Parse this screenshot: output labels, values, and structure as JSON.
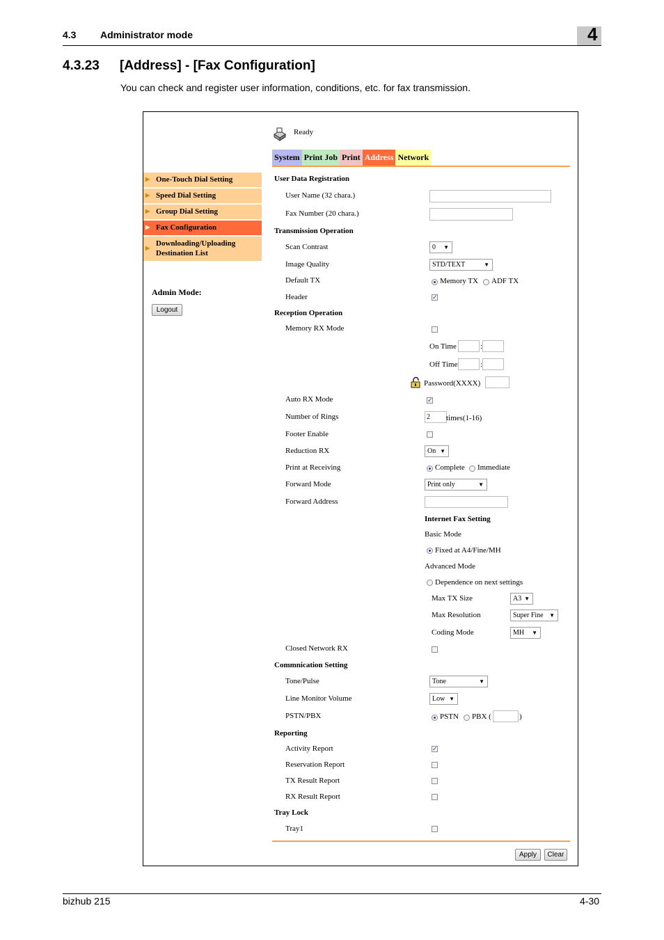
{
  "header": {
    "section_num": "4.3",
    "section_title": "Administrator mode",
    "chapter": "4"
  },
  "title": {
    "num": "4.3.23",
    "text": "[Address] - [Fax Configuration]"
  },
  "intro": "You can check and register user information, conditions, etc. for fax transmission.",
  "status": {
    "text": "Ready",
    "icon": "printer-icon"
  },
  "tabs": [
    "System",
    "Print Job",
    "Print",
    "Address",
    "Network"
  ],
  "active_tab": "Address",
  "sidebar": {
    "items": [
      {
        "label": "One-Touch Dial Setting"
      },
      {
        "label": "Speed Dial Setting"
      },
      {
        "label": "Group Dial Setting"
      },
      {
        "label": "Fax Configuration"
      },
      {
        "label1": "Downloading/Uploading",
        "label2": "Destination List"
      }
    ],
    "active": "Fax Configuration",
    "admin_mode_label": "Admin Mode:",
    "logout_label": "Logout"
  },
  "form": {
    "user_data": {
      "heading": "User Data Registration",
      "user_name_label": "User Name (32 chara.)",
      "user_name_value": "",
      "fax_number_label": "Fax Number (20 chara.)",
      "fax_number_value": ""
    },
    "transmission": {
      "heading": "Transmission Operation",
      "scan_contrast_label": "Scan Contrast",
      "scan_contrast_value": "0",
      "image_quality_label": "Image Quality",
      "image_quality_value": "STD/TEXT",
      "default_tx_label": "Default TX",
      "default_tx_opt1": "Memory TX",
      "default_tx_opt2": "ADF TX",
      "default_tx_selected": "Memory TX",
      "header_label": "Header",
      "header_checked": true
    },
    "reception": {
      "heading": "Reception Operation",
      "memory_rx_label": "Memory RX Mode",
      "memory_rx_checked": false,
      "on_time_label": "On Time",
      "off_time_label": "Off Time",
      "time_sep": ":",
      "password_label": "Password(XXXX)",
      "lock_icon": "lock-icon",
      "auto_rx_label": "Auto RX Mode",
      "auto_rx_checked": true,
      "rings_label": "Number of Rings",
      "rings_value": "2",
      "rings_suffix": "times(1-16)",
      "footer_label": "Footer Enable",
      "footer_checked": false,
      "reduction_label": "Reduction RX",
      "reduction_value": "On",
      "print_receiving_label": "Print at Receiving",
      "print_opt1": "Complete",
      "print_opt2": "Immediate",
      "print_selected": "Complete",
      "forward_mode_label": "Forward Mode",
      "forward_mode_value": "Print only",
      "forward_address_label": "Forward Address",
      "forward_address_value": "",
      "internet_fax_heading": "Internet Fax Setting",
      "basic_mode_label": "Basic Mode",
      "basic_mode_opt": "Fixed at A4/Fine/MH",
      "advanced_mode_label": "Advanced Mode",
      "advanced_mode_opt": "Dependence on next settings",
      "max_tx_label": "Max TX Size",
      "max_tx_value": "A3",
      "max_res_label": "Max Resolution",
      "max_res_value": "Super Fine",
      "coding_label": "Coding Mode",
      "coding_value": "MH",
      "closed_network_label": "Closed Network RX",
      "closed_network_checked": false
    },
    "communication": {
      "heading": "Commnication Setting",
      "tone_pulse_label": "Tone/Pulse",
      "tone_pulse_value": "Tone",
      "line_monitor_label": "Line Monitor Volume",
      "line_monitor_value": "Low",
      "pstn_label": "PSTN/PBX",
      "pstn_opt1": "PSTN",
      "pstn_opt2": "PBX (",
      "pstn_close": ")",
      "pstn_selected": "PSTN"
    },
    "reporting": {
      "heading": "Reporting",
      "activity_label": "Activity Report",
      "activity_checked": true,
      "reservation_label": "Reservation Report",
      "reservation_checked": false,
      "tx_result_label": "TX Result Report",
      "tx_result_checked": false,
      "rx_result_label": "RX Result Report",
      "rx_result_checked": false
    },
    "tray_lock": {
      "heading": "Tray Lock",
      "tray1_label": "Tray1",
      "tray1_checked": false
    },
    "apply_label": "Apply",
    "clear_label": "Clear"
  },
  "footer": {
    "product": "bizhub 215",
    "page": "4-30"
  },
  "colors": {
    "accent_orange": "#ff6a3a",
    "sidebar_bg": "#ffcf94",
    "rule_orange": "#f5a050"
  }
}
